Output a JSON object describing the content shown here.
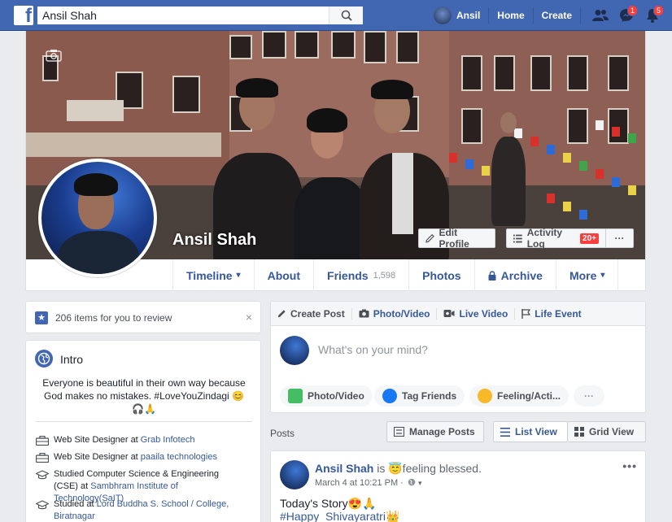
{
  "topbar": {
    "search_value": "Ansil Shah",
    "user_name": "Ansil",
    "home_label": "Home",
    "create_label": "Create",
    "messages_badge": "1",
    "notifications_badge": "5",
    "colors": {
      "brand": "#4267b2",
      "badge": "#fa3e3e"
    }
  },
  "profile": {
    "name": "Ansil Shah",
    "edit_profile_label": "Edit Profile",
    "activity_log_label": "Activity Log",
    "activity_log_count": "20+",
    "more_button_label": "···"
  },
  "tabs": [
    {
      "label": "Timeline",
      "suffix": "▾"
    },
    {
      "label": "About",
      "suffix": ""
    },
    {
      "label": "Friends",
      "sub": "1,598"
    },
    {
      "label": "Photos",
      "suffix": ""
    },
    {
      "label": "Archive",
      "suffix": ""
    },
    {
      "label": "More",
      "suffix": "▾"
    }
  ],
  "review": {
    "text": "206 items for you to review",
    "close": "×"
  },
  "intro": {
    "title": "Intro",
    "bio": "Everyone is beautiful in their own way because God makes no mistakes. #LoveYouZindagi 😊🎧🙏",
    "items": [
      {
        "prefix": "Web Site Designer at ",
        "link": "Grab Infotech"
      },
      {
        "prefix": "Web Site Designer at ",
        "link": "paaila technologies"
      },
      {
        "prefix": "Studied Computer Science & Engineering (CSE) at ",
        "link": "Sambhram Institute of Technology(SaIT)"
      },
      {
        "prefix": "Studied at ",
        "link": "Lord Buddha S. School / College, Biratnagar"
      }
    ]
  },
  "composer": {
    "tabs": [
      "Create Post",
      "Photo/Video",
      "Live Video",
      "Life Event"
    ],
    "placeholder": "What's on your mind?",
    "actions": [
      "Photo/Video",
      "Tag Friends",
      "Feeling/Acti...",
      "···"
    ]
  },
  "posts_section": {
    "label": "Posts",
    "manage_label": "Manage Posts",
    "list_view_label": "List View",
    "grid_view_label": "Grid View"
  },
  "post": {
    "author": "Ansil Shah",
    "status": " is 😇feeling blessed.",
    "time": "March 4 at 10:21 PM ·",
    "more": "•••",
    "line1": "Today's Story😍🙏",
    "line2": "#Happy_Shivayaratri👑"
  }
}
